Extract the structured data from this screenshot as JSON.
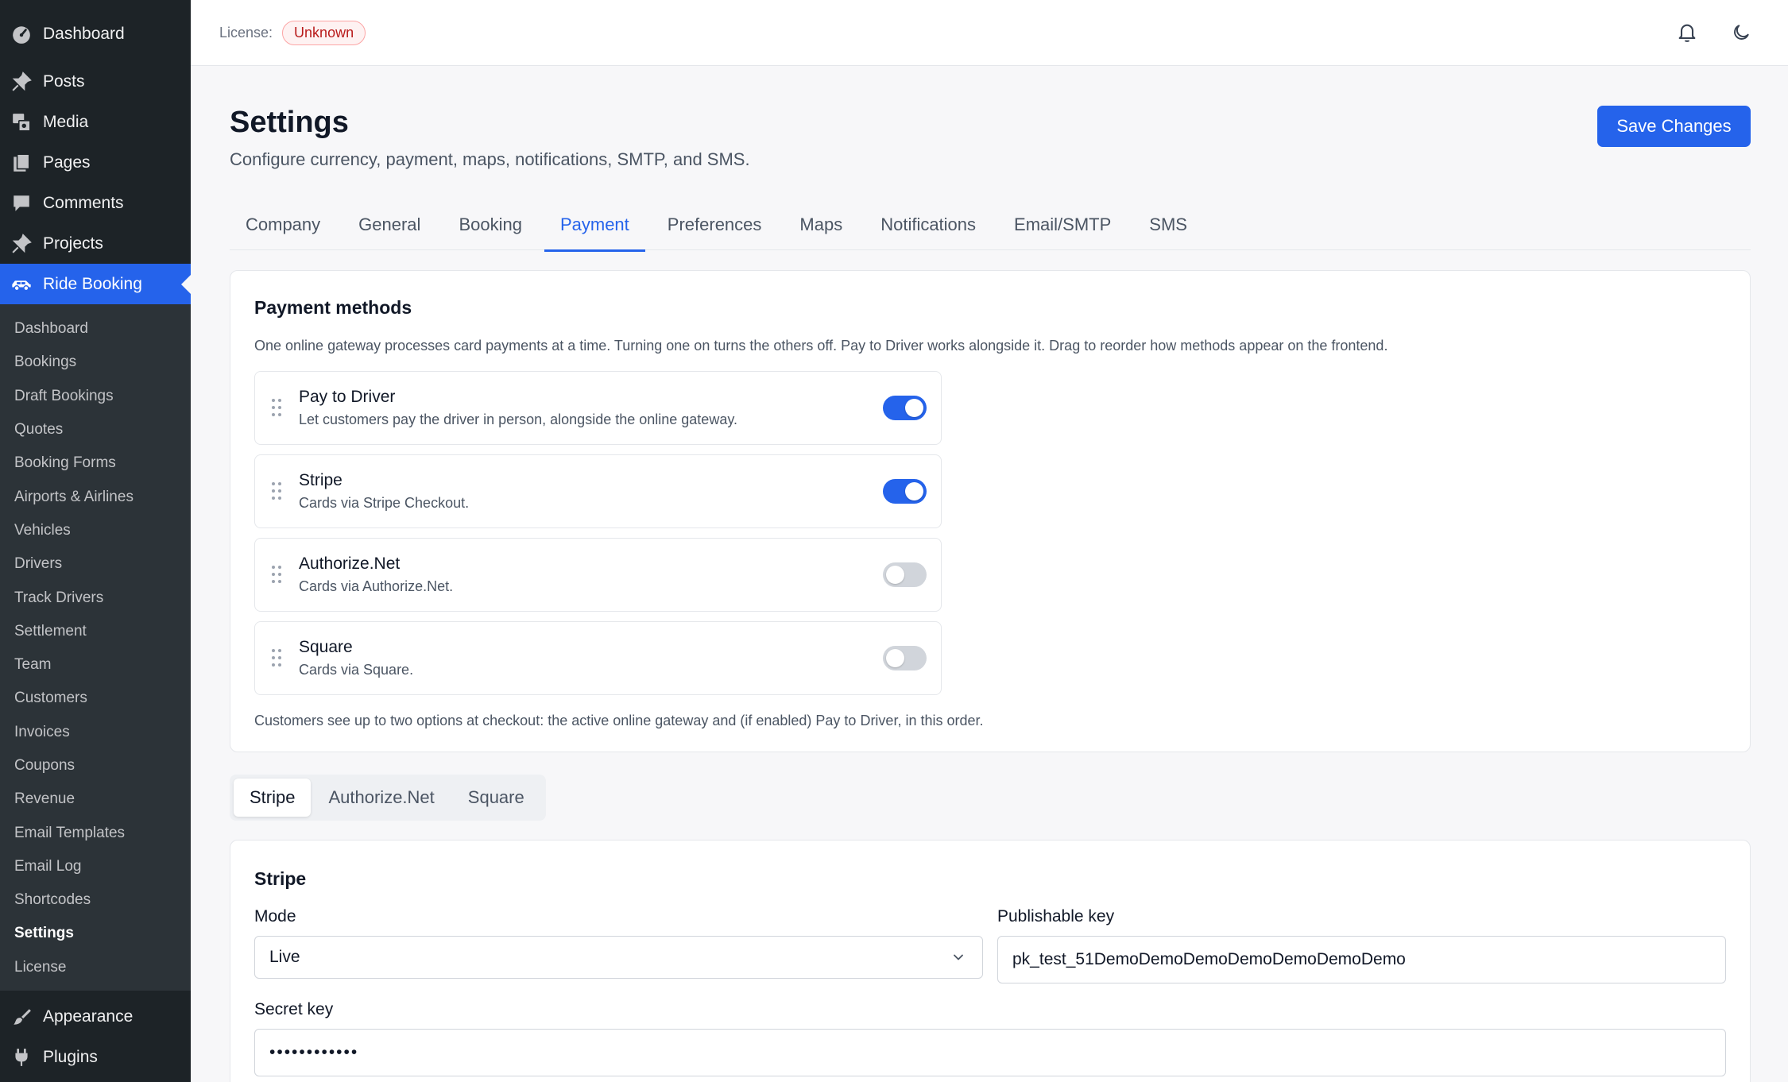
{
  "sidebar": {
    "top_items": [
      {
        "label": "Dashboard",
        "icon": "dashboard-icon"
      },
      {
        "label": "Posts",
        "icon": "pin-icon"
      },
      {
        "label": "Media",
        "icon": "media-icon"
      },
      {
        "label": "Pages",
        "icon": "pages-icon"
      },
      {
        "label": "Comments",
        "icon": "comment-icon"
      },
      {
        "label": "Projects",
        "icon": "pin-icon"
      },
      {
        "label": "Ride Booking",
        "icon": "car-icon"
      }
    ],
    "submenu": [
      "Dashboard",
      "Bookings",
      "Draft Bookings",
      "Quotes",
      "Booking Forms",
      "Airports & Airlines",
      "Vehicles",
      "Drivers",
      "Track Drivers",
      "Settlement",
      "Team",
      "Customers",
      "Invoices",
      "Coupons",
      "Revenue",
      "Email Templates",
      "Email Log",
      "Shortcodes",
      "Settings",
      "License"
    ],
    "current_submenu": "Settings",
    "bottom_items": [
      {
        "label": "Appearance",
        "icon": "brush-icon"
      },
      {
        "label": "Plugins",
        "icon": "plug-icon"
      }
    ]
  },
  "topbar": {
    "license_label": "License:",
    "license_status": "Unknown",
    "icons": [
      "bell-icon",
      "moon-icon"
    ]
  },
  "header": {
    "title": "Settings",
    "subtitle": "Configure currency, payment, maps, notifications, SMTP, and SMS.",
    "save_label": "Save Changes"
  },
  "tabs": [
    "Company",
    "General",
    "Booking",
    "Payment",
    "Preferences",
    "Maps",
    "Notifications",
    "Email/SMTP",
    "SMS"
  ],
  "active_tab": "Payment",
  "payment_methods": {
    "title": "Payment methods",
    "description": "One online gateway processes card payments at a time. Turning one on turns the others off. Pay to Driver works alongside it. Drag to reorder how methods appear on the frontend.",
    "methods": [
      {
        "name": "Pay to Driver",
        "desc": "Let customers pay the driver in person, alongside the online gateway.",
        "enabled": true
      },
      {
        "name": "Stripe",
        "desc": "Cards via Stripe Checkout.",
        "enabled": true
      },
      {
        "name": "Authorize.Net",
        "desc": "Cards via Authorize.Net.",
        "enabled": false
      },
      {
        "name": "Square",
        "desc": "Cards via Square.",
        "enabled": false
      }
    ],
    "footer_note": "Customers see up to two options at checkout: the active online gateway and (if enabled) Pay to Driver, in this order."
  },
  "gateway_tabs": [
    "Stripe",
    "Authorize.Net",
    "Square"
  ],
  "active_gateway_tab": "Stripe",
  "stripe": {
    "title": "Stripe",
    "mode_label": "Mode",
    "mode_value": "Live",
    "publishable_label": "Publishable key",
    "publishable_value": "pk_test_51DemoDemoDemoDemoDemoDemoDemo",
    "secret_label": "Secret key",
    "secret_value": "••••••••••••"
  },
  "colors": {
    "accent": "#2563eb",
    "sidebar_bg": "#1d2327",
    "badge_red": "#b91c1c"
  }
}
